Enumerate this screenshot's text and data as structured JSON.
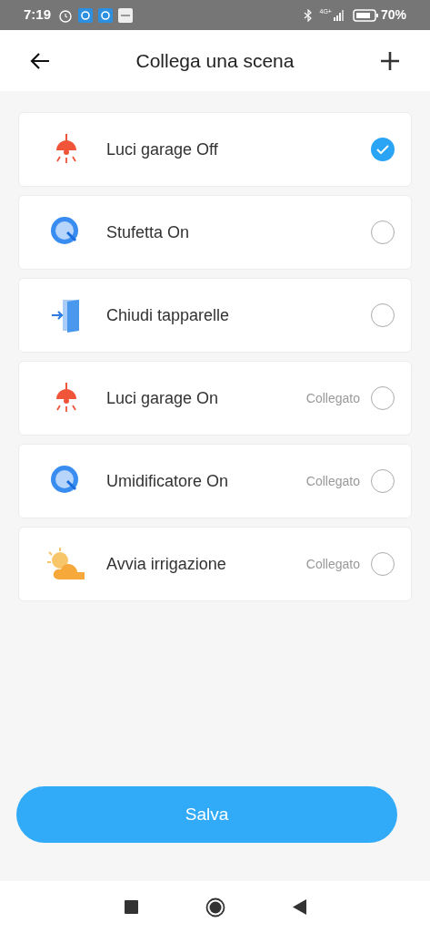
{
  "status_bar": {
    "time": "7:19",
    "network": "4G+",
    "battery": "70%"
  },
  "header": {
    "title": "Collega una scena"
  },
  "scenes": [
    {
      "kind": "lamp",
      "label": "Luci garage Off",
      "selected": true
    },
    {
      "kind": "magnifier",
      "label": "Stufetta On",
      "selected": false
    },
    {
      "kind": "door",
      "label": "Chiudi tapparelle",
      "selected": false
    },
    {
      "kind": "lamp",
      "label": "Luci garage On",
      "status": "Collegato",
      "selected": false
    },
    {
      "kind": "magnifier",
      "label": "Umidificatore On",
      "status": "Collegato",
      "selected": false
    },
    {
      "kind": "weather",
      "label": "Avvia irrigazione",
      "status": "Collegato",
      "selected": false
    }
  ],
  "save_button": {
    "label": "Salva"
  }
}
